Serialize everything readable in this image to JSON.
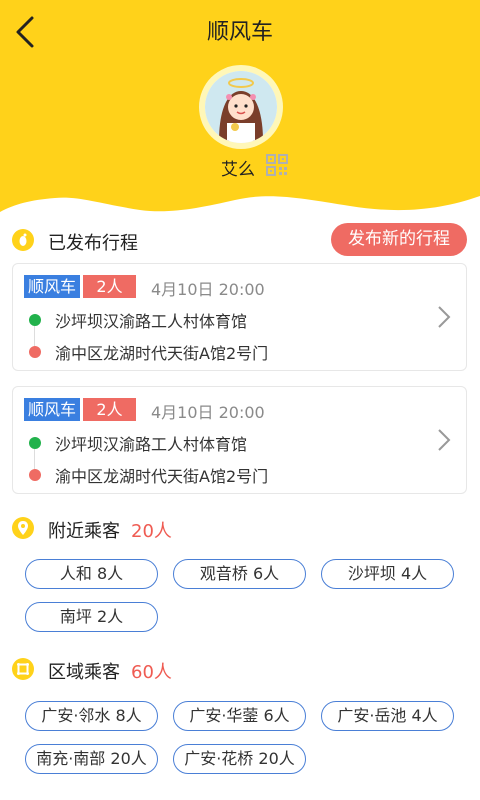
{
  "header": {
    "title": "顺风车",
    "username": "艾么"
  },
  "published": {
    "title": "已发布行程",
    "publish_btn": "发布新的行程",
    "trips": [
      {
        "tag": "顺风车",
        "seats": "2人",
        "time": "4月10日  20:00",
        "from": "沙坪坝汉渝路工人村体育馆",
        "to": "渝中区龙湖时代天街A馆2号门"
      },
      {
        "tag": "顺风车",
        "seats": "2人",
        "time": "4月10日  20:00",
        "from": "沙坪坝汉渝路工人村体育馆",
        "to": "渝中区龙湖时代天街A馆2号门"
      }
    ]
  },
  "nearby": {
    "title": "附近乘客",
    "count": "20人",
    "chips": [
      "人和 8人",
      "观音桥 6人",
      "沙坪坝 4人",
      "南坪 2人"
    ]
  },
  "region": {
    "title": "区域乘客",
    "count": "60人",
    "chips": [
      "广安·邻水 8人",
      "广安·华蓥 6人",
      "广安·岳池 4人",
      "南充·南部 20人",
      "广安·花桥 20人"
    ]
  },
  "colors": {
    "header_yellow": "#ffd21a",
    "accent_red": "#ef6b63",
    "tag_blue": "#3a7fe0",
    "chip_border": "#4a7fd6",
    "route_green": "#22b24c"
  }
}
